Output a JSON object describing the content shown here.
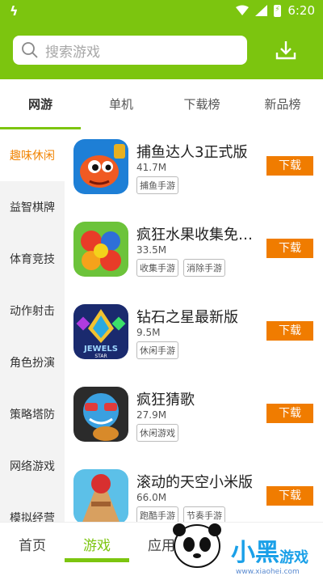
{
  "status": {
    "time": "6:20",
    "app_icon": "ϟ"
  },
  "search": {
    "placeholder": "搜索游戏"
  },
  "tabs": [
    {
      "label": "网游",
      "active": true
    },
    {
      "label": "单机"
    },
    {
      "label": "下载榜"
    },
    {
      "label": "新品榜"
    }
  ],
  "sidebar": [
    {
      "label": "趣味休闲"
    },
    {
      "label": "益智棋牌"
    },
    {
      "label": "体育竞技"
    },
    {
      "label": "动作射击"
    },
    {
      "label": "角色扮演"
    },
    {
      "label": "策略塔防"
    },
    {
      "label": "网络游戏"
    },
    {
      "label": "模拟经营"
    }
  ],
  "games": [
    {
      "title": "捕鱼达人3正式版",
      "size": "41.7M",
      "tags": [
        "捕鱼手游"
      ],
      "download": "下载"
    },
    {
      "title": "疯狂水果收集免…",
      "size": "33.5M",
      "tags": [
        "收集手游",
        "消除手游"
      ],
      "download": "下载"
    },
    {
      "title": "钻石之星最新版",
      "size": "9.5M",
      "tags": [
        "休闲手游"
      ],
      "download": "下载"
    },
    {
      "title": "疯狂猜歌",
      "size": "27.9M",
      "tags": [
        "休闲游戏"
      ],
      "download": "下载"
    },
    {
      "title": "滚动的天空小米版",
      "size": "66.0M",
      "tags": [
        "跑酷手游",
        "节奏手游"
      ],
      "download": "下载"
    }
  ],
  "bottomnav": [
    {
      "label": "首页"
    },
    {
      "label": "游戏",
      "active": true
    },
    {
      "label": "应用"
    }
  ],
  "watermark": {
    "text": "小黑游戏",
    "url": "www.xiaohei.com"
  },
  "colors": {
    "brand": "#7cc50f",
    "accent": "#f07c00"
  }
}
